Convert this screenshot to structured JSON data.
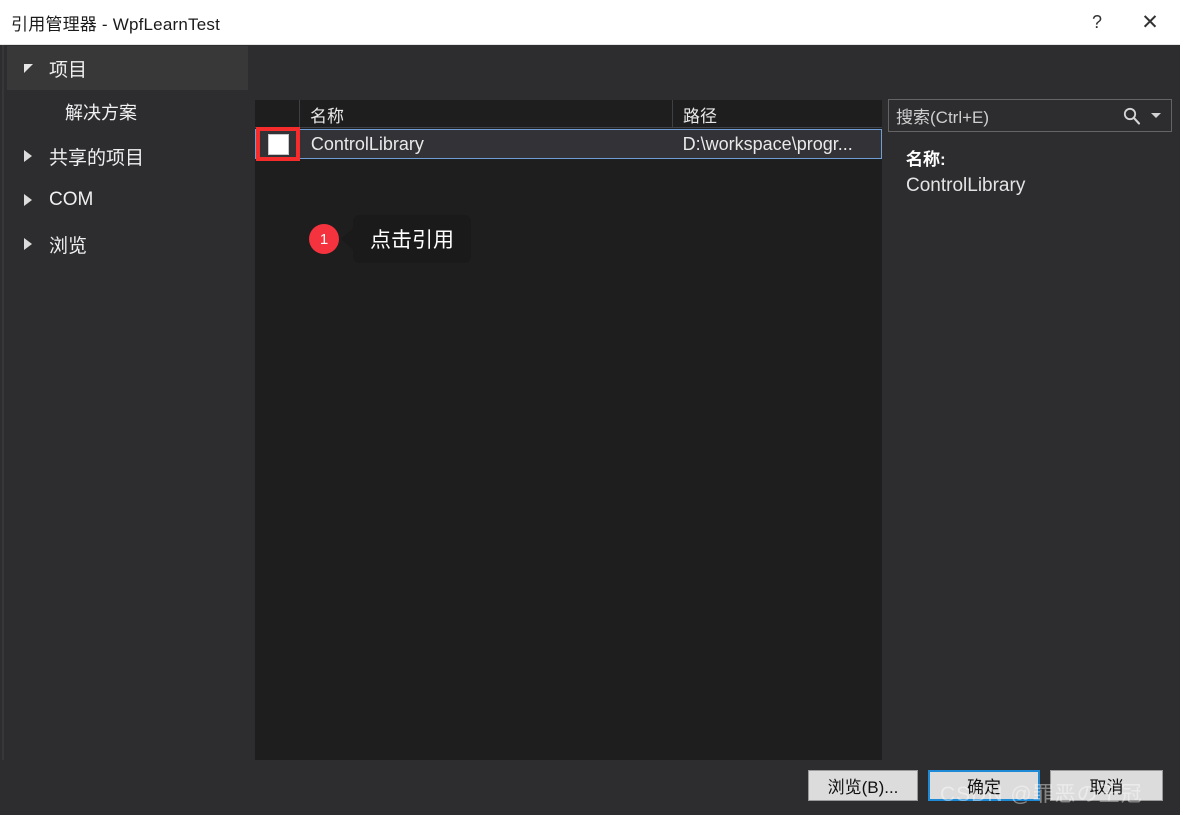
{
  "window": {
    "title": "引用管理器 - WpfLearnTest",
    "help_label": "?",
    "close_label": "✕"
  },
  "sidebar": {
    "items": [
      {
        "label": "项目",
        "icon": "chevron-down-icon",
        "expanded": true,
        "selected": true
      },
      {
        "label": "解决方案",
        "icon": "none",
        "child": true,
        "selected": false
      },
      {
        "label": "共享的项目",
        "icon": "chevron-right-icon",
        "expanded": false,
        "selected": false
      },
      {
        "label": "COM",
        "icon": "chevron-right-icon",
        "expanded": false,
        "selected": false
      },
      {
        "label": "浏览",
        "icon": "chevron-right-icon",
        "expanded": false,
        "selected": false
      }
    ]
  },
  "search": {
    "placeholder": "搜索(Ctrl+E)",
    "value": "",
    "icon": "search-icon",
    "dropdown_icon": "chevron-down-icon"
  },
  "list": {
    "columns": {
      "check": "",
      "name": "名称",
      "path": "路径"
    },
    "rows": [
      {
        "checked": false,
        "name": "ControlLibrary",
        "path": "D:\\workspace\\progr..."
      }
    ]
  },
  "details": {
    "name_label": "名称:",
    "name_value": "ControlLibrary"
  },
  "annotation": {
    "badge_number": "1",
    "tooltip_text": "点击引用",
    "highlight_color": "#f42c2c",
    "badge_color": "#f5333f"
  },
  "footer": {
    "browse_label": "浏览(B)...",
    "ok_label": "确定",
    "cancel_label": "取消"
  },
  "watermark": {
    "text": "CSDN @罪恶の王冠"
  }
}
